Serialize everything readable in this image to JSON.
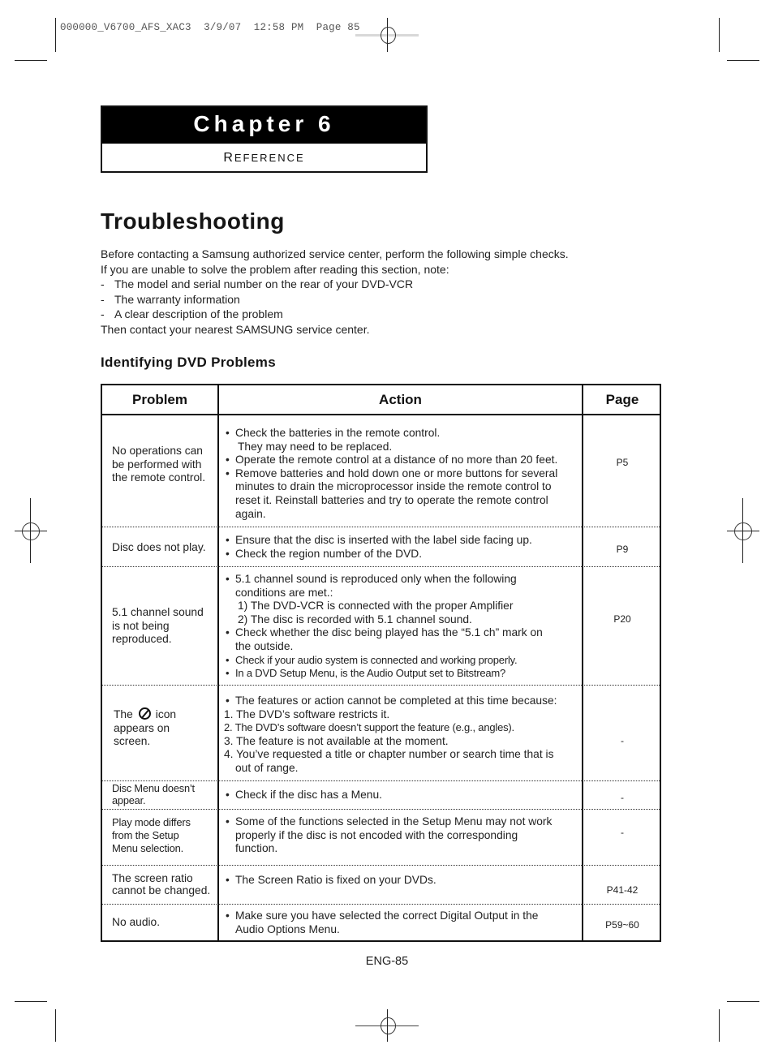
{
  "print_slug": "000000_V6700_AFS_XAC3  3/9/07  12:58 PM  Page 85",
  "chapter": {
    "title": "Chapter 6",
    "subtitle_initial": "R",
    "subtitle_rest": "EFERENCE"
  },
  "page_title": "Troubleshooting",
  "intro": {
    "line1": "Before contacting a Samsung authorized service center, perform the following simple checks.",
    "line2": "If you are unable to solve the problem after reading this section, note:",
    "items": [
      "The model and serial number on the rear of your DVD-VCR",
      "The warranty information",
      "A clear description of the problem"
    ],
    "dash": "-",
    "closing": "Then contact your nearest SAMSUNG service center."
  },
  "section_title": "Identifying DVD Problems",
  "table": {
    "headers": {
      "problem": "Problem",
      "action": "Action",
      "page": "Page"
    },
    "bullet": "•",
    "rows": [
      {
        "problem": "No operations can be performed with the remote control.",
        "actions": [
          "Check the batteries in the remote control.",
          "They may need to be replaced.",
          "Operate the remote control at a distance of no more than 20 feet.",
          "Remove batteries and hold down one or more buttons for several",
          "minutes to drain the microprocessor inside the remote control to",
          "reset it. Reinstall batteries and try to operate the remote control",
          "again."
        ],
        "page": "P5"
      },
      {
        "problem": "Disc does not play.",
        "actions": [
          "Ensure that the disc is inserted with the label side facing up.",
          "Check the region number of the DVD."
        ],
        "page": "P9"
      },
      {
        "problem": "5.1 channel sound is not being reproduced.",
        "actions": [
          "5.1 channel sound is reproduced only when the following",
          "conditions are met.:",
          "1) The DVD-VCR is connected with the proper Amplifier",
          "2) The disc is recorded with 5.1 channel sound.",
          "Check whether the disc being played has the “5.1 ch” mark on",
          "the outside.",
          "Check if your audio system is connected and working properly.",
          "In a DVD Setup Menu, is the Audio Output set to Bitstream?"
        ],
        "page": "P20"
      },
      {
        "problem_prefix": "The",
        "problem_icon": "prohibited-icon",
        "problem_suffix": "icon",
        "problem_rest": "appears on screen.",
        "actions": [
          "The features or action cannot be completed at this time because:",
          "1. The DVD’s software restricts it.",
          "2. The DVD’s software doesn’t support the feature (e.g., angles).",
          "3. The feature is not available at the moment.",
          "4. You’ve requested a title or chapter number or search time that is",
          "out of range."
        ],
        "page": "-"
      },
      {
        "problem": "Disc Menu doesn’t appear.",
        "actions": [
          "Check if the disc has a Menu."
        ],
        "page": "-"
      },
      {
        "problem": "Play mode differs from the Setup Menu selection.",
        "actions": [
          "Some of the functions selected in the Setup Menu may not work",
          "properly if the disc is not encoded with the corresponding",
          "function."
        ],
        "page": "-"
      },
      {
        "problem": "The screen ratio cannot be changed.",
        "actions": [
          "The Screen Ratio is fixed on your DVDs."
        ],
        "page": "P41-42"
      },
      {
        "problem": "No audio.",
        "actions": [
          "Make sure you have selected the correct Digital Output in the",
          "Audio Options Menu."
        ],
        "page": "P59~60"
      }
    ]
  },
  "page_number": "ENG-85"
}
